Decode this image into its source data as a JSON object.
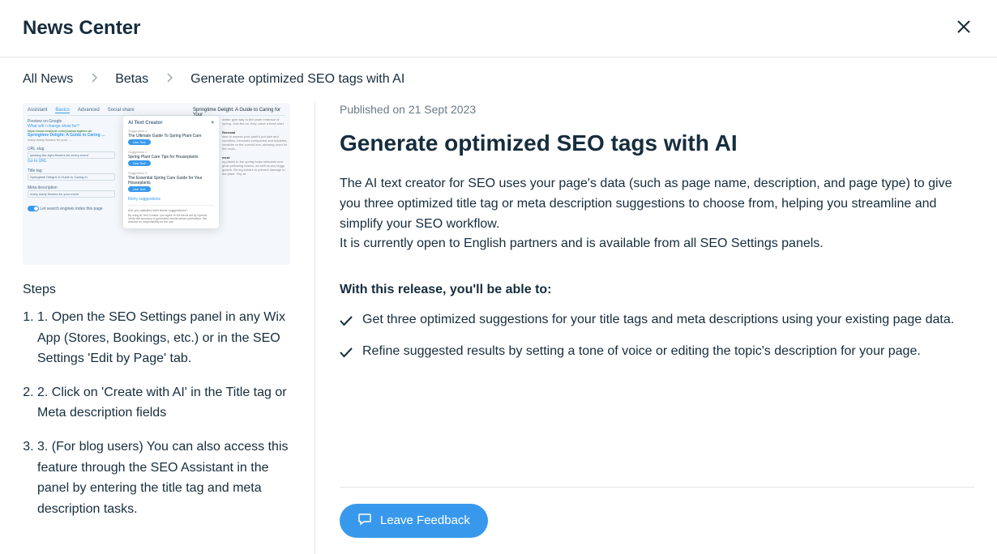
{
  "header": {
    "title": "News Center"
  },
  "breadcrumb": {
    "items": [
      "All News",
      "Betas",
      "Generate optimized SEO tags with AI"
    ]
  },
  "thumbnail": {
    "tabs": [
      "Assistant",
      "Basics",
      "Advanced",
      "Social share"
    ],
    "article_heading": "Springtime Delight: A Guide to Caring for Your",
    "preview_label": "Preview on Google",
    "preview_sub": "What will I change show for?",
    "preview_title": "Springtime Delight: A Guide to Caring …",
    "url_sec": "URL slug",
    "url_value": "/picking-the-right-flowers-for-every-event",
    "goto": "Go to URL",
    "title_tag_label": "Title tag",
    "title_tag_value": "Springtime Delight: A Guide to Caring fo",
    "meta_label": "Meta description",
    "meta_value": "many many flowers for your event",
    "index_label": "Let search engines index this page",
    "popup_title": "AI Text Creator",
    "use_text": "Use Text",
    "suggestions": [
      {
        "label": "Suggestion 1",
        "text": "The Ultimate Guide To Spring Plant Care"
      },
      {
        "label": "Suggestion 2",
        "text": "Spring Plant Care Tips for Houseplants"
      },
      {
        "label": "Suggestion 3",
        "text": "The Essential Spring Care Guide for Your Houseplants"
      }
    ],
    "retry": "Retry suggestions",
    "satisfied": "Are you satisfied with these suggestions?",
    "disclaimer": "By using AI Text Creator, you agree to the terms set by OpenAI. Verify the accuracy of generated results before publication. We assume no responsibility for the use."
  },
  "steps": {
    "title": "Steps",
    "items": [
      "1. Open the SEO Settings panel in any Wix App (Stores, Bookings, etc.) or in the SEO Settings 'Edit by Page' tab.",
      "2. Click on 'Create with AI' in the Title tag or Meta description fields",
      "3. (For blog users) You can also access this feature through the SEO Assistant in the panel by entering the title tag and meta description tasks."
    ]
  },
  "article": {
    "published": "Published on 21 Sept 2023",
    "title": "Generate optimized SEO tags with AI",
    "para1": "The AI text creator for SEO uses your page's data (such as page name, description, and page type)  to give you three optimized title tag or meta description suggestions to choose from, helping you streamline and simplify your SEO workflow.",
    "para2": "It is currently open to English partners and is available from all SEO Settings panels.",
    "subhead": "With this release, you'll be able to:",
    "bullets": [
      "Get three optimized suggestions for your title tags and meta descriptions using your existing page data.",
      "Refine suggested results by setting a tone of voice or editing the topic's description for your page."
    ],
    "feedback_label": "Leave Feedback"
  }
}
